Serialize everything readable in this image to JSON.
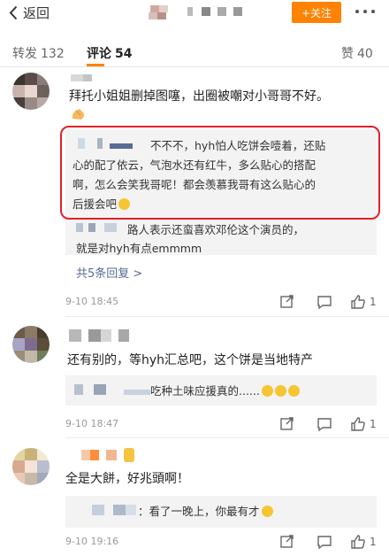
{
  "header": {
    "back_label": "返回",
    "follow_label": "+关注",
    "accent_color": "#ff8200"
  },
  "tabs": [
    {
      "label": "转发",
      "count": "132"
    },
    {
      "label": "评论",
      "count": "54"
    },
    {
      "label": "赞",
      "count": "40"
    }
  ],
  "comments": [
    {
      "text_line1": "拜托小姐姐删掉图噻，出圈被嘲对小哥哥不好。",
      "replies": [
        {
          "line1": "不不不，hyh怕人吃饼会噎着，还贴",
          "line2": "心的配了依云，气泡水还有红牛，多么贴心的搭配",
          "line3": "啊，怎么会笑我哥呢！都会羡慕我哥有这么贴心的",
          "line4": "后援会吧"
        },
        {
          "line1": "路人表示还蛮喜欢邓伦这个演员的，",
          "line2": "就是对hyh有点emmmm"
        }
      ],
      "more_replies": "共5条回复 >",
      "time": "9-10 18:45",
      "likes": "1"
    },
    {
      "text": "还有别的，等hyh汇总吧，这个饼是当地特产",
      "reply": "吃种土味应援真的......",
      "time": "9-10 18:47",
      "likes": "1"
    },
    {
      "text": "全是大餅，好兆頭啊！",
      "reply": "：看了一晚上，你最有才",
      "time": "9-10 19:16",
      "likes": "1"
    }
  ]
}
